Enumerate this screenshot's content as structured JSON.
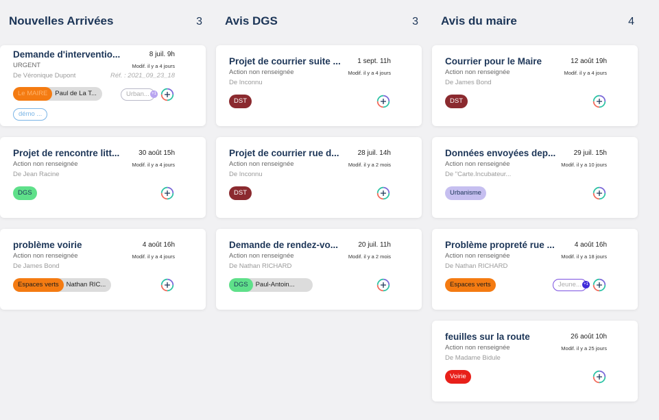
{
  "columns": [
    {
      "title": "Nouvelles Arrivées",
      "count": "3",
      "cards": [
        {
          "title": "Demande d'interventio...",
          "date": "8 juil. 9h",
          "status": "URGENT",
          "modif": "Modif. il y a 4 jours",
          "from": "De Véronique Dupont",
          "ref": "Réf. : 2021_09_23_18",
          "tag_group": [
            "Le MAIRE",
            "Paul de La T..."
          ],
          "outline_pill": "Urban...",
          "outline_badge": "+1",
          "outline_pill_2": "démo ..."
        },
        {
          "title": "Projet de rencontre litt...",
          "date": "30 août 15h",
          "status": "Action non renseignée",
          "modif": "Modif. il y a 4 jours",
          "from": "De Jean Racine",
          "tag": "DGS"
        },
        {
          "title": "problème voirie",
          "date": "4 août 16h",
          "status": "Action non renseignée",
          "modif": "Modif. il y a 4 jours",
          "from": "De James Bond",
          "tag_group": [
            "Espaces verts",
            "Nathan RIC..."
          ]
        }
      ]
    },
    {
      "title": "Avis DGS",
      "count": "3",
      "cards": [
        {
          "title": "Projet de courrier suite ...",
          "date": "1 sept. 11h",
          "status": "Action non renseignée",
          "modif": "Modif. il y a 4 jours",
          "from": "De Inconnu",
          "tag": "DST"
        },
        {
          "title": "Projet de courrier rue d...",
          "date": "28 juil. 14h",
          "status": "Action non renseignée",
          "modif": "Modif. il y a 2 mois",
          "from": "De Inconnu",
          "tag": "DST"
        },
        {
          "title": "Demande de rendez-vo...",
          "date": "20 juil. 11h",
          "status": "Action non renseignée",
          "modif": "Modif. il y a 2 mois",
          "from": "De Nathan RICHARD",
          "tag_group": [
            "DGS",
            "Paul-Antoin..."
          ]
        }
      ]
    },
    {
      "title": "Avis du maire",
      "count": "4",
      "cards": [
        {
          "title": "Courrier pour le Maire",
          "date": "12 août 19h",
          "status": "Action non renseignée",
          "modif": "Modif. il y a 4 jours",
          "from": "De James Bond",
          "tag": "DST"
        },
        {
          "title": "Données envoyées dep...",
          "date": "29 juil. 15h",
          "status": "Action non renseignée",
          "modif": "Modif. il y a 10 jours",
          "from": "De \"Carte.Incubateur...",
          "tag": "Urbanisme"
        },
        {
          "title": "Problème propreté rue ...",
          "date": "4 août 16h",
          "status": "Action non renseignée",
          "modif": "Modif. il y a 18 jours",
          "from": "De Nathan RICHARD",
          "tag": "Espaces verts",
          "outline_pill": "Jeune...",
          "outline_badge": "+1"
        },
        {
          "title": "feuilles sur la route",
          "date": "26 août 10h",
          "status": "Action non renseignée",
          "modif": "Modif. il y a 25 jours",
          "from": "De Madame Bidule",
          "tag": "Voirie"
        }
      ]
    }
  ],
  "colors": {
    "tag_dst": "#8b2a2f",
    "tag_dgs": "#5fe08a",
    "tag_orange": "#f47b12",
    "tag_urbanisme": "#c6bff0",
    "tag_voirie": "#e8201a",
    "pill_blue": "#79b4e6",
    "pill_purple": "#7a4fe0"
  },
  "icons": {
    "add": "add-circle-icon"
  }
}
